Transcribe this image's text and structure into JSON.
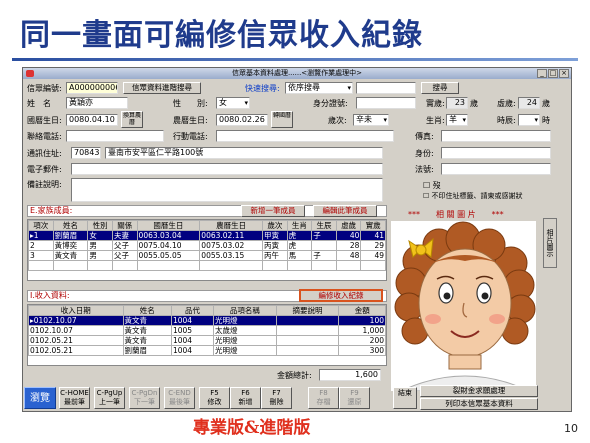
{
  "slide": {
    "title": "同一畫面可編修信眾收入紀錄",
    "footer": "專業版&進階版",
    "page_number": "10"
  },
  "window": {
    "title": "信眾基本資料處理......<瀏覽作業處理中>"
  },
  "header": {
    "member_id_label": "信眾編號:",
    "member_id": "A000000006",
    "advanced_search_button": "信眾資料進階搜尋",
    "quick_search_label": "快速搜尋:",
    "quick_search_mode": "依序搜尋",
    "search_button": "搜尋",
    "real_age_label": "實歲:",
    "real_age": "23",
    "virtual_age_label": "虛歲:",
    "virtual_age": "24",
    "age_unit": "歲"
  },
  "person": {
    "name_label": "姓　名",
    "name": "黃穎亦",
    "gender_label": "性　　別:",
    "gender": "女",
    "id_card_label": "身分證號:",
    "id_card": "",
    "birth_label": "國曆生日:",
    "birth_solar": "0080.04.10",
    "convert_lunar_button": "換算農曆",
    "lunar_birth_label": "農曆生日:",
    "birth_lunar": "0080.02.26",
    "convert_solar_button": "轉國曆",
    "ganzhi_label": "歲次:",
    "ganzhi": "辛未",
    "zodiac_label": "生肖:",
    "zodiac": "羊",
    "time_label": "時辰:",
    "time_suffix": "時",
    "contact_label": "聯絡電話:",
    "mobile_label": "行動電話:",
    "fax_label": "傳真:",
    "address_label": "通訊住址:",
    "zip": "70843",
    "address": "臺南市安平區仁平路100號",
    "identity_label": "身份:",
    "email_label": "電子郵件:",
    "dharma_name_label": "法號:",
    "note_label": "備註說明:",
    "checkbox_deceased": "歿",
    "checkbox_no_print": "不印住址標籤、請東或感謝狀"
  },
  "family": {
    "section_label": "E.家族成員:",
    "add_button": "新增一筆成員",
    "batch_edit_button": "編輯此筆成員",
    "columns": [
      "項次",
      "姓名",
      "性別",
      "關係",
      "國曆生日",
      "農曆生日",
      "歲次",
      "生肖",
      "生辰",
      "虛歲",
      "實歲"
    ],
    "rows": [
      [
        "1",
        "劉蘭眉",
        "女",
        "夫妻",
        "0063.03.04",
        "0063.02.11",
        "甲寅",
        "虎",
        "子",
        "40",
        "41"
      ],
      [
        "2",
        "黃博奕",
        "男",
        "父子",
        "0075.04.10",
        "0075.03.02",
        "丙寅",
        "虎",
        "",
        "28",
        "29"
      ],
      [
        "3",
        "黃文青",
        "男",
        "父子",
        "0055.05.05",
        "0055.03.15",
        "丙午",
        "馬",
        "子",
        "48",
        "49"
      ]
    ]
  },
  "photo": {
    "label": "***　　相 關 圖 片　　***",
    "side_tab": "相片圖示"
  },
  "income": {
    "section_label": "I.收入資料:",
    "edit_button": "編修收入紀錄",
    "columns": [
      "收入日期",
      "姓名",
      "品代",
      "品項名稱",
      "摘要說明",
      "金額"
    ],
    "rows": [
      [
        "0102.10.07",
        "黃文青",
        "1004",
        "光明燈",
        "",
        "100"
      ],
      [
        "0102.10.07",
        "黃文青",
        "1005",
        "太歲燈",
        "",
        "1,000"
      ],
      [
        "0102.05.21",
        "黃文青",
        "1004",
        "光明燈",
        "",
        "200"
      ],
      [
        "0102.05.21",
        "劉蘭眉",
        "1004",
        "光明燈",
        "",
        "300"
      ]
    ],
    "total_label": "金額總計:",
    "total": "1,600"
  },
  "toolbar": {
    "browse": "瀏覽",
    "keys": [
      {
        "top": "C-HOME",
        "bottom": "最前筆"
      },
      {
        "top": "C-PgUp",
        "bottom": "上一筆"
      },
      {
        "top": "C-PgDn",
        "bottom": "下一筆"
      },
      {
        "top": "C-END",
        "bottom": "最後筆"
      },
      {
        "top": "F5",
        "bottom": "修改"
      },
      {
        "top": "F6",
        "bottom": "新增"
      },
      {
        "top": "F7",
        "bottom": "刪除"
      },
      {
        "top": "F8",
        "bottom": "存檔"
      },
      {
        "top": "F9",
        "bottom": "還原"
      },
      {
        "top": "",
        "bottom": "結束"
      }
    ],
    "guide_button": "裂財金求願處理",
    "print_button": "列印本信眾基本資料"
  },
  "colors": {
    "title_blue": "#1f3b8c",
    "footer_red": "#e0301e",
    "selection_navy": "#000080",
    "highlight_border": "#d9531e"
  }
}
